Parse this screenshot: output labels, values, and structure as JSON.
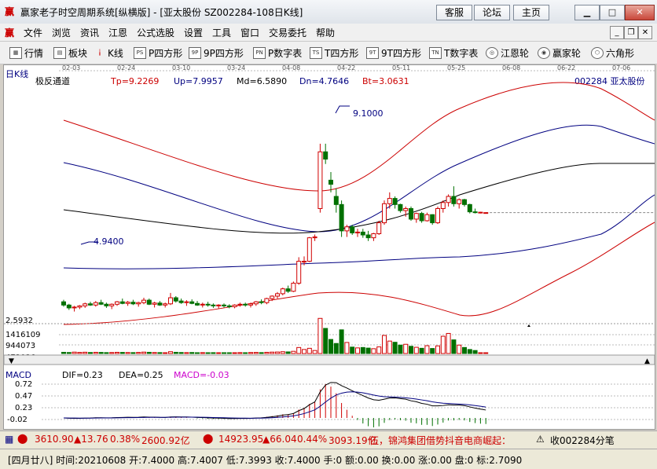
{
  "window": {
    "title": "赢家老子时空周期系统[纵横版] - [亚太股份   SZ002284-108日K线]",
    "buttons": [
      "客服",
      "论坛",
      "主页"
    ]
  },
  "menu": [
    "文件",
    "浏览",
    "资讯",
    "江恩",
    "公式选股",
    "设置",
    "工具",
    "窗口",
    "交易委托",
    "帮助"
  ],
  "toolbar": [
    "行情",
    "板块",
    "K线",
    "P四方形",
    "9P四方形",
    "P数字表",
    "T四方形",
    "9T四方形",
    "T数字表",
    "江恩轮",
    "赢家轮",
    "六角形"
  ],
  "toolbar_icons": [
    "grid-icon",
    "blocks-icon",
    "candles-icon",
    "ps-icon",
    "9p-icon",
    "pn-icon",
    "ts-icon",
    "9t-icon",
    "tn-icon",
    "gann-wheel-icon",
    "winner-wheel-icon",
    "hexagon-icon"
  ],
  "chart": {
    "period_label": "日K线",
    "indicator": {
      "name": "极反通道",
      "tp": "Tp=9.2269",
      "up": "Up=7.9957",
      "md": "Md=6.5890",
      "dn": "Dn=4.7646",
      "bt": "Bt=3.0631"
    },
    "stock_label": "002284  亚太股份",
    "dates": [
      "02-03",
      "02-24",
      "03-10",
      "03-24",
      "04-08",
      "04-22",
      "05-11",
      "05-25",
      "06-08",
      "06-22",
      "07-06"
    ],
    "high_annotation": "9.1000",
    "low_annotation": "4.9400",
    "price_axis": "2.5932",
    "volume_axis": [
      "1416109",
      "944073",
      "472036"
    ],
    "macd": {
      "title": "MACD",
      "dif": "DIF=0.23",
      "dea": "DEA=0.25",
      "macd": "MACD=-0.03",
      "axis": [
        "0.72",
        "0.47",
        "0.23",
        "-0.02"
      ]
    }
  },
  "status": {
    "index1": "3610.90",
    "index1_change": "▲13.76",
    "index1_pct": "0.38%",
    "index1_amount": "2600.92亿",
    "index2": "14923.95",
    "index2_change": "▲66.04",
    "index2_pct": "0.44%",
    "index2_amount": "3093.19亿",
    "news": "伍，锦鸿集团借势抖音电商崛起：",
    "stock_note": "收002284分笔",
    "detail": "[四月廿八] 时间:20210608 开:7.4000 高:7.4007 低:7.3993 收:7.4000 手:0 额:0.00 换:0.00 涨:0.00 盘:0 标:2.7090"
  },
  "chart_data": {
    "type": "candlestick",
    "x": [
      "02-03",
      "02-04",
      "02-05",
      "02-08",
      "02-09",
      "02-10",
      "02-18",
      "02-19",
      "02-22",
      "02-23",
      "02-24",
      "02-25",
      "02-26",
      "03-01",
      "03-02",
      "03-03",
      "03-04",
      "03-05",
      "03-08",
      "03-09",
      "03-10",
      "03-11",
      "03-12",
      "03-15",
      "03-16",
      "03-17",
      "03-18",
      "03-19",
      "03-22",
      "03-23",
      "03-24",
      "03-25",
      "03-26",
      "03-29",
      "03-30",
      "03-31",
      "04-01",
      "04-02",
      "04-06",
      "04-07",
      "04-08",
      "04-09",
      "04-12",
      "04-13",
      "04-14",
      "04-15",
      "04-16",
      "04-19",
      "04-20",
      "04-21",
      "04-22",
      "04-23",
      "04-26",
      "04-27",
      "04-28",
      "04-29",
      "04-30",
      "05-06",
      "05-07",
      "05-10",
      "05-11",
      "05-12",
      "05-13",
      "05-14",
      "05-17",
      "05-18",
      "05-19",
      "05-20",
      "05-21",
      "05-24",
      "05-25",
      "05-26",
      "05-27",
      "05-28",
      "05-31",
      "06-01",
      "06-02",
      "06-03",
      "06-04",
      "06-07",
      "06-08"
    ],
    "ohlc": [
      [
        5.2,
        5.25,
        5.08,
        5.12
      ],
      [
        5.12,
        5.15,
        5.0,
        5.05
      ],
      [
        5.05,
        5.1,
        4.96,
        5.07
      ],
      [
        5.07,
        5.12,
        5.02,
        5.1
      ],
      [
        5.1,
        5.18,
        5.05,
        5.15
      ],
      [
        5.15,
        5.2,
        5.1,
        5.12
      ],
      [
        5.12,
        5.22,
        5.08,
        5.18
      ],
      [
        5.18,
        5.25,
        5.12,
        5.14
      ],
      [
        5.14,
        5.18,
        5.05,
        5.1
      ],
      [
        5.1,
        5.16,
        5.02,
        5.14
      ],
      [
        5.14,
        5.22,
        5.1,
        5.2
      ],
      [
        5.2,
        5.28,
        5.14,
        5.16
      ],
      [
        5.16,
        5.22,
        5.1,
        5.19
      ],
      [
        5.19,
        5.25,
        5.12,
        5.15
      ],
      [
        5.15,
        5.2,
        5.08,
        5.18
      ],
      [
        5.18,
        5.3,
        5.14,
        5.24
      ],
      [
        5.24,
        5.28,
        5.12,
        5.14
      ],
      [
        5.14,
        5.2,
        5.06,
        5.17
      ],
      [
        5.17,
        5.22,
        5.1,
        5.12
      ],
      [
        5.12,
        5.18,
        5.06,
        5.15
      ],
      [
        5.15,
        5.42,
        5.12,
        5.3
      ],
      [
        5.3,
        5.34,
        5.18,
        5.22
      ],
      [
        5.22,
        5.28,
        5.15,
        5.18
      ],
      [
        5.18,
        5.24,
        5.1,
        5.2
      ],
      [
        5.2,
        5.26,
        5.14,
        5.16
      ],
      [
        5.16,
        5.22,
        5.1,
        5.12
      ],
      [
        5.12,
        5.18,
        5.06,
        5.14
      ],
      [
        5.14,
        5.2,
        5.08,
        5.12
      ],
      [
        5.12,
        5.16,
        5.05,
        5.1
      ],
      [
        5.1,
        5.14,
        5.04,
        5.12
      ],
      [
        5.12,
        5.16,
        5.06,
        5.1
      ],
      [
        5.1,
        5.14,
        5.04,
        5.08
      ],
      [
        5.08,
        5.14,
        5.04,
        5.12
      ],
      [
        5.12,
        5.18,
        5.08,
        5.14
      ],
      [
        5.14,
        5.18,
        5.08,
        5.12
      ],
      [
        5.12,
        5.18,
        5.06,
        5.15
      ],
      [
        5.15,
        5.22,
        5.1,
        5.2
      ],
      [
        5.2,
        5.26,
        5.14,
        5.18
      ],
      [
        5.18,
        5.3,
        5.14,
        5.28
      ],
      [
        5.28,
        5.36,
        5.22,
        5.34
      ],
      [
        5.34,
        5.44,
        5.28,
        5.4
      ],
      [
        5.4,
        5.55,
        5.36,
        5.52
      ],
      [
        5.52,
        5.6,
        5.42,
        5.46
      ],
      [
        5.46,
        5.7,
        5.44,
        5.66
      ],
      [
        5.66,
        6.3,
        5.62,
        6.2
      ],
      [
        6.2,
        6.32,
        6.1,
        6.2
      ],
      [
        6.2,
        6.8,
        6.18,
        6.78
      ],
      [
        6.78,
        6.86,
        6.7,
        6.8
      ],
      [
        7.5,
        9.1,
        7.4,
        8.9
      ],
      [
        8.9,
        9.1,
        8.6,
        8.72
      ],
      [
        8.2,
        8.4,
        7.9,
        8.1
      ],
      [
        7.8,
        8.0,
        7.4,
        7.6
      ],
      [
        7.6,
        7.7,
        6.8,
        6.95
      ],
      [
        6.95,
        7.1,
        6.8,
        7.05
      ],
      [
        7.05,
        7.1,
        6.85,
        6.9
      ],
      [
        6.9,
        7.0,
        6.8,
        6.92
      ],
      [
        6.92,
        7.0,
        6.78,
        6.85
      ],
      [
        6.85,
        6.95,
        6.7,
        6.78
      ],
      [
        6.78,
        6.9,
        6.7,
        6.88
      ],
      [
        6.88,
        7.2,
        6.85,
        7.15
      ],
      [
        7.15,
        7.7,
        7.1,
        7.62
      ],
      [
        7.62,
        7.9,
        7.5,
        7.75
      ],
      [
        7.75,
        7.8,
        7.5,
        7.6
      ],
      [
        7.6,
        7.62,
        7.4,
        7.45
      ],
      [
        7.45,
        7.55,
        7.3,
        7.5
      ],
      [
        7.5,
        7.55,
        7.2,
        7.24
      ],
      [
        7.24,
        7.4,
        7.15,
        7.38
      ],
      [
        7.38,
        7.42,
        7.15,
        7.2
      ],
      [
        7.2,
        7.4,
        7.18,
        7.35
      ],
      [
        7.35,
        7.36,
        7.1,
        7.15
      ],
      [
        7.15,
        7.55,
        7.12,
        7.5
      ],
      [
        7.5,
        7.7,
        7.4,
        7.65
      ],
      [
        7.65,
        7.85,
        7.55,
        7.8
      ],
      [
        7.8,
        8.05,
        7.55,
        7.62
      ],
      [
        7.62,
        7.75,
        7.5,
        7.72
      ],
      [
        7.72,
        7.74,
        7.55,
        7.6
      ],
      [
        7.6,
        7.62,
        7.38,
        7.42
      ],
      [
        7.42,
        7.5,
        7.38,
        7.4
      ],
      [
        7.4,
        7.42,
        7.38,
        7.41
      ],
      [
        7.4,
        7.4007,
        7.3993,
        7.4
      ]
    ],
    "volume": [
      60000,
      50000,
      70000,
      55000,
      65000,
      50000,
      60000,
      55000,
      45000,
      50000,
      60000,
      55000,
      50000,
      45000,
      55000,
      70000,
      60000,
      50000,
      45000,
      40000,
      90000,
      60000,
      50000,
      45000,
      50000,
      40000,
      45000,
      40000,
      42000,
      38000,
      40000,
      35000,
      40000,
      45000,
      40000,
      50000,
      55000,
      45000,
      60000,
      70000,
      75000,
      90000,
      80000,
      110000,
      300000,
      200000,
      260000,
      150000,
      1750000,
      1250000,
      700000,
      500000,
      1180000,
      550000,
      320000,
      280000,
      300000,
      270000,
      240000,
      330000,
      900000,
      620000,
      560000,
      420000,
      460000,
      360000,
      310000,
      260000,
      390000,
      250000,
      380000,
      860000,
      1000000,
      680000,
      420000,
      300000,
      200000,
      150000,
      0,
      0
    ]
  }
}
